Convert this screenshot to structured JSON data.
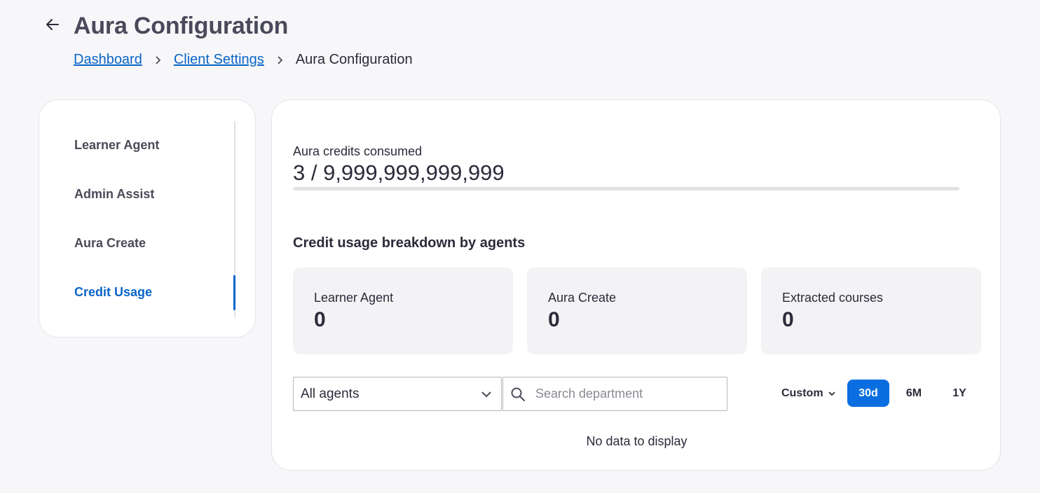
{
  "header": {
    "title": "Aura Configuration",
    "breadcrumb": [
      {
        "label": "Dashboard"
      },
      {
        "label": "Client Settings"
      },
      {
        "label": "Aura Configuration"
      }
    ]
  },
  "sidebar": {
    "items": [
      {
        "label": "Learner Agent",
        "active": false
      },
      {
        "label": "Admin Assist",
        "active": false
      },
      {
        "label": "Aura Create",
        "active": false
      },
      {
        "label": "Credit Usage",
        "active": true
      }
    ]
  },
  "credits": {
    "label": "Aura credits consumed",
    "value": "3 / 9,999,999,999,999",
    "used": 3,
    "total": 9999999999999
  },
  "breakdown": {
    "title": "Credit usage breakdown by agents",
    "cards": [
      {
        "label": "Learner Agent",
        "value": "0"
      },
      {
        "label": "Aura Create",
        "value": "0"
      },
      {
        "label": "Extracted courses",
        "value": "0"
      }
    ]
  },
  "filters": {
    "agent_select": "All agents",
    "search_placeholder": "Search department",
    "custom_label": "Custom",
    "ranges": [
      {
        "label": "30d",
        "active": true
      },
      {
        "label": "6M",
        "active": false
      },
      {
        "label": "1Y",
        "active": false
      }
    ]
  },
  "empty_message": "No data to display",
  "colors": {
    "accent": "#0a64c8",
    "active_range": "#0a6ee0",
    "background": "#f7f7f9"
  }
}
